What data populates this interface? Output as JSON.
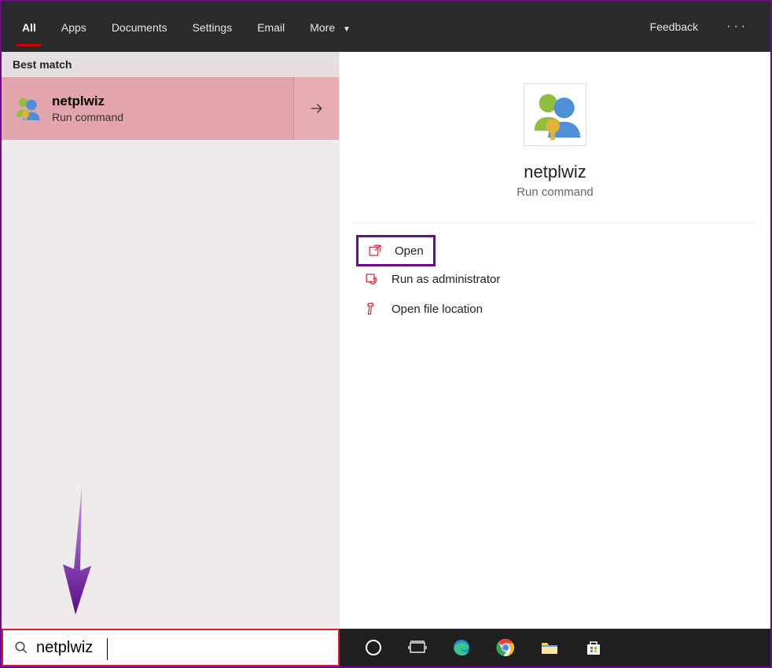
{
  "tabs": {
    "all": "All",
    "apps": "Apps",
    "documents": "Documents",
    "settings": "Settings",
    "email": "Email",
    "more": "More",
    "feedback": "Feedback"
  },
  "left": {
    "best_match_header": "Best match",
    "result": {
      "title": "netplwiz",
      "subtitle": "Run command"
    }
  },
  "detail": {
    "title": "netplwiz",
    "subtitle": "Run command",
    "actions": {
      "open": "Open",
      "run_admin": "Run as administrator",
      "open_loc": "Open file location"
    }
  },
  "search": {
    "value": "netplwiz"
  }
}
